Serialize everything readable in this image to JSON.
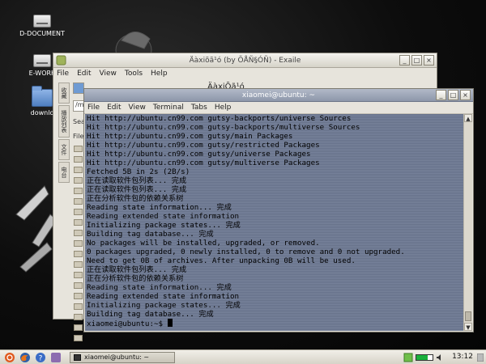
{
  "desktop": {
    "icons": [
      {
        "label": "D-DOCUMENT",
        "kind": "drive"
      },
      {
        "label": "E-WORK",
        "kind": "drive"
      },
      {
        "label": "downlo",
        "kind": "folder"
      }
    ]
  },
  "exaile": {
    "title": "Äàxiõã¹ó (by ÕÅÑ§ÓÑ) - Exaile",
    "menu": [
      "File",
      "Edit",
      "View",
      "Tools",
      "Help"
    ],
    "vertical_tabs": [
      "收藏",
      "播放列表",
      "文件",
      "电台"
    ],
    "header_title": "ÄàxiÕã¹ó",
    "path_value": "/m",
    "search_label": "Sea",
    "file_column": "File",
    "folder_rows": 19
  },
  "terminal": {
    "title": "xiaomei@ubuntu: ~",
    "menu": [
      "File",
      "Edit",
      "View",
      "Terminal",
      "Tabs",
      "Help"
    ],
    "lines": [
      "Hit http://ubuntu.cn99.com gutsy-backports/universe Sources",
      "Hit http://ubuntu.cn99.com gutsy-backports/multiverse Sources",
      "Hit http://ubuntu.cn99.com gutsy/main Packages",
      "Hit http://ubuntu.cn99.com gutsy/restricted Packages",
      "Hit http://ubuntu.cn99.com gutsy/universe Packages",
      "Hit http://ubuntu.cn99.com gutsy/multiverse Packages",
      "Fetched 5B in 2s (2B/s)",
      "正在读取软件包列表... 完成",
      "正在读取软件包列表... 完成",
      "正在分析软件包的依赖关系树",
      "Reading state information... 完成",
      "Reading extended state information",
      "Initializing package states... 完成",
      "Building tag database... 完成",
      "No packages will be installed, upgraded, or removed.",
      "0 packages upgraded, 0 newly installed, 0 to remove and 0 not upgraded.",
      "Need to get 0B of archives. After unpacking 0B will be used.",
      "正在读取软件包列表... 完成",
      "正在分析软件包的依赖关系树",
      "Reading state information... 完成",
      "Reading extended state information",
      "Initializing package states... 完成",
      "Building tag database... 完成"
    ],
    "prompt": "xiaomei@ubuntu:~$ "
  },
  "taskbar": {
    "task_label": "xiaomei@ubuntu: ~",
    "clock": "13:12"
  },
  "colors": {
    "terminal_bg": "#6b7791",
    "terminal_title": "#8d97aa",
    "panel": "#e7e4dc"
  }
}
